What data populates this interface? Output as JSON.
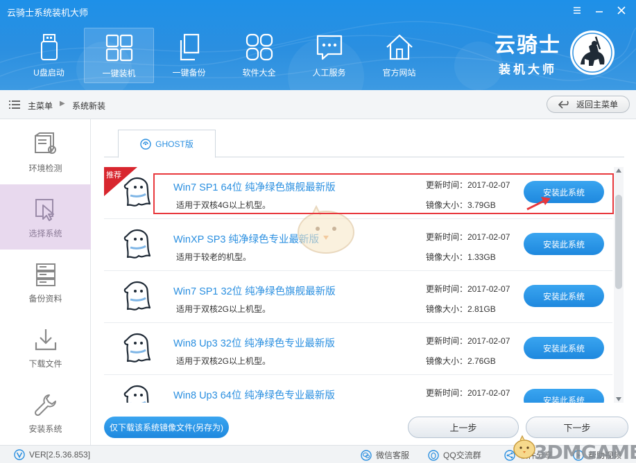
{
  "window": {
    "title": "云骑士系统装机大师",
    "controls": [
      "menu-icon",
      "minimize-icon",
      "close-icon"
    ]
  },
  "nav": [
    {
      "label": "U盘启动",
      "icon": "usb-drive-icon",
      "active": false
    },
    {
      "label": "一键装机",
      "icon": "windows-logo-icon",
      "active": true
    },
    {
      "label": "一键备份",
      "icon": "backup-copy-icon",
      "active": false
    },
    {
      "label": "软件大全",
      "icon": "software-grid-icon",
      "active": false
    },
    {
      "label": "人工服务",
      "icon": "chat-bubble-icon",
      "active": false
    },
    {
      "label": "官方网站",
      "icon": "home-icon",
      "active": false
    }
  ],
  "logo": {
    "name": "云骑士",
    "subtitle": "装机大师"
  },
  "breadcrumb": {
    "root": "主菜单",
    "current": "系统新装"
  },
  "back_button": "返回主菜单",
  "sidebar": [
    {
      "label": "环境检测",
      "icon": "hardware-check-icon",
      "active": false
    },
    {
      "label": "选择系统",
      "icon": "cursor-select-icon",
      "active": true
    },
    {
      "label": "备份资料",
      "icon": "server-stack-icon",
      "active": false
    },
    {
      "label": "下载文件",
      "icon": "download-icon",
      "active": false
    },
    {
      "label": "安装系统",
      "icon": "wrench-icon",
      "active": false
    }
  ],
  "tab": {
    "label": "GHOST版"
  },
  "systems": [
    {
      "title": "Win7 SP1 64位 纯净绿色旗舰最新版",
      "desc": "适用于双核4G以上机型。",
      "updated": "更新时间：2017-02-07",
      "size": "镜像大小：3.79GB",
      "button": "安装此系统",
      "badge": "推荐"
    },
    {
      "title": "WinXP SP3 纯净绿色专业最新版",
      "desc": "适用于较老的机型。",
      "updated": "更新时间：2017-02-07",
      "size": "镜像大小：1.33GB",
      "button": "安装此系统"
    },
    {
      "title": "Win7 SP1 32位 纯净绿色旗舰最新版",
      "desc": "适用于双核2G以上机型。",
      "updated": "更新时间：2017-02-07",
      "size": "镜像大小：2.81GB",
      "button": "安装此系统"
    },
    {
      "title": "Win8 Up3 32位 纯净绿色专业最新版",
      "desc": "适用于双核2G以上机型。",
      "updated": "更新时间：2017-02-07",
      "size": "镜像大小：2.76GB",
      "button": "安装此系统"
    },
    {
      "title": "Win8 Up3 64位 纯净绿色专业最新版",
      "desc": "",
      "updated": "更新时间：2017-02-07",
      "size": "",
      "button": "安装此系统"
    }
  ],
  "bottom": {
    "download_only": "仅下载该系统镜像文件(另存为)",
    "prev": "上一步",
    "next": "下一步"
  },
  "footer": {
    "version": "VER[2.5.36.853]",
    "wechat": "微信客服",
    "qq": "QQ交流群",
    "share": "软件分享",
    "help": "帮助视频",
    "watermark": "3DMGAME"
  },
  "colors": {
    "accent": "#2a8fe0",
    "header": "#2b8fe0",
    "highlight": "#e8383d",
    "sidebar_active": "#e8d9ee"
  }
}
